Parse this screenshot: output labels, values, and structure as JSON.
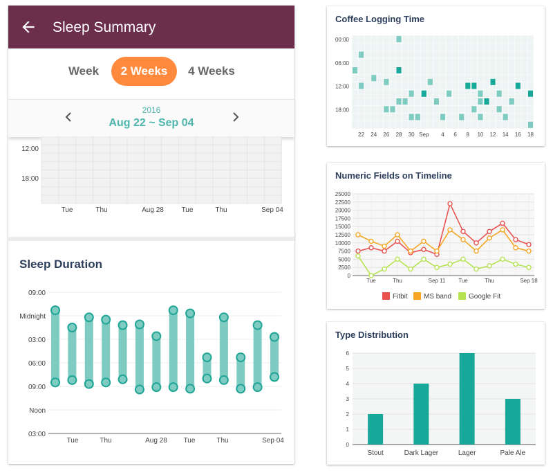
{
  "app": {
    "title": "Sleep Summary",
    "tabs": [
      "Week",
      "2 Weeks",
      "4 Weeks"
    ],
    "active_tab": "2 Weeks",
    "year": "2016",
    "date_range": "Aug 22 ~ Sep 04",
    "accent": "#4cb6ac",
    "header_color": "#6b2e4b",
    "tab_active_color": "#ff8a3d"
  },
  "sleep_overview": {
    "y_ticks": [
      "12:00",
      "18:00"
    ],
    "x_ticks": [
      "Tue",
      "Thu",
      "Aug 28",
      "Tue",
      "Thu",
      "Sep 04"
    ]
  },
  "sleep_duration": {
    "title": "Sleep Duration",
    "y_ticks": [
      "09:00",
      "Midnight",
      "03:00",
      "06:00",
      "09:00",
      "Noon",
      "03:00"
    ],
    "x_ticks": [
      "Tue",
      "Thu",
      "Aug 28",
      "Tue",
      "Thu",
      "Sep 04"
    ]
  },
  "coffee": {
    "title": "Coffee Logging Time",
    "y_ticks": [
      "00:00",
      "06:00",
      "12:00",
      "18:00"
    ],
    "x_ticks": [
      "22",
      "24",
      "26",
      "28",
      "30",
      "Sep",
      "4",
      "6",
      "8",
      "10",
      "12",
      "14",
      "16",
      "18"
    ]
  },
  "numeric": {
    "title": "Numeric Fields on Timeline",
    "y_ticks": [
      "25000",
      "22500",
      "20000",
      "17500",
      "15000",
      "12500",
      "10000",
      "7500",
      "5000",
      "2500",
      "0"
    ],
    "x_ticks": [
      "Tue",
      "Thu",
      "Sep 11",
      "Tue",
      "Thu",
      "Sep 18"
    ],
    "legend": [
      "Fitbit",
      "MS band",
      "Google Fit"
    ],
    "colors": [
      "#e8524f",
      "#f5a623",
      "#b5e352"
    ]
  },
  "type_dist": {
    "title": "Type Distribution",
    "color": "#17a89a"
  },
  "chart_data": [
    {
      "type": "heatmap",
      "title": "Coffee Logging Time",
      "x": [
        "Aug 21",
        "Aug 22",
        "Aug 23",
        "Aug 24",
        "Aug 25",
        "Aug 26",
        "Aug 27",
        "Aug 28",
        "Aug 29",
        "Aug 30",
        "Aug 31",
        "Sep 1",
        "Sep 2",
        "Sep 3",
        "Sep 4",
        "Sep 5",
        "Sep 6",
        "Sep 7",
        "Sep 8",
        "Sep 9",
        "Sep 10",
        "Sep 11",
        "Sep 12",
        "Sep 13",
        "Sep 14",
        "Sep 15",
        "Sep 16",
        "Sep 17",
        "Sep 18"
      ],
      "y_hours": [
        0,
        6,
        12,
        18
      ],
      "cells": [
        {
          "day": "Aug 22",
          "hour": 4,
          "level": 1
        },
        {
          "day": "Aug 21",
          "hour": 8,
          "level": 1
        },
        {
          "day": "Aug 22",
          "hour": 12,
          "level": 1
        },
        {
          "day": "Aug 24",
          "hour": 10,
          "level": 1
        },
        {
          "day": "Aug 26",
          "hour": 11,
          "level": 1
        },
        {
          "day": "Aug 28",
          "hour": 0,
          "level": 1
        },
        {
          "day": "Aug 28",
          "hour": 8,
          "level": 2
        },
        {
          "day": "Aug 28",
          "hour": 16,
          "level": 1
        },
        {
          "day": "Aug 26",
          "hour": 18,
          "level": 1
        },
        {
          "day": "Aug 27",
          "hour": 18,
          "level": 1
        },
        {
          "day": "Aug 29",
          "hour": 16,
          "level": 1
        },
        {
          "day": "Aug 30",
          "hour": 14,
          "level": 1
        },
        {
          "day": "Aug 30",
          "hour": 20,
          "level": 1
        },
        {
          "day": "Aug 31",
          "hour": 20,
          "level": 1
        },
        {
          "day": "Sep 1",
          "hour": 14,
          "level": 2
        },
        {
          "day": "Sep 2",
          "hour": 11,
          "level": 1
        },
        {
          "day": "Sep 3",
          "hour": 16,
          "level": 1
        },
        {
          "day": "Sep 4",
          "hour": 20,
          "level": 1
        },
        {
          "day": "Sep 5",
          "hour": 14,
          "level": 1
        },
        {
          "day": "Sep 7",
          "hour": 20,
          "level": 1
        },
        {
          "day": "Sep 8",
          "hour": 12,
          "level": 2
        },
        {
          "day": "Sep 9",
          "hour": 12,
          "level": 2
        },
        {
          "day": "Sep 9",
          "hour": 18,
          "level": 1
        },
        {
          "day": "Sep 10",
          "hour": 14,
          "level": 1
        },
        {
          "day": "Sep 10",
          "hour": 16,
          "level": 1
        },
        {
          "day": "Sep 10",
          "hour": 20,
          "level": 1
        },
        {
          "day": "Sep 11",
          "hour": 16,
          "level": 2
        },
        {
          "day": "Sep 12",
          "hour": 11,
          "level": 2
        },
        {
          "day": "Sep 13",
          "hour": 14,
          "level": 1
        },
        {
          "day": "Sep 13",
          "hour": 18,
          "level": 1
        },
        {
          "day": "Sep 14",
          "hour": 20,
          "level": 1
        },
        {
          "day": "Sep 15",
          "hour": 16,
          "level": 1
        },
        {
          "day": "Sep 16",
          "hour": 12,
          "level": 2
        },
        {
          "day": "Sep 18",
          "hour": 14,
          "level": 2
        },
        {
          "day": "Sep 18",
          "hour": 22,
          "level": 1
        }
      ]
    },
    {
      "type": "line",
      "title": "Numeric Fields on Timeline",
      "x": [
        "Sep 5",
        "Sep 6",
        "Sep 7",
        "Sep 8",
        "Sep 9",
        "Sep 10",
        "Sep 11",
        "Sep 12",
        "Sep 13",
        "Sep 14",
        "Sep 15",
        "Sep 16",
        "Sep 17",
        "Sep 18"
      ],
      "ylim": [
        0,
        25000
      ],
      "series": [
        {
          "name": "Fitbit",
          "values": [
            7500,
            8500,
            7500,
            10500,
            7000,
            8000,
            6500,
            22000,
            13500,
            10000,
            13500,
            16000,
            11000,
            9500
          ]
        },
        {
          "name": "MS band",
          "values": [
            12500,
            10500,
            9000,
            12500,
            7500,
            10500,
            7500,
            14000,
            11000,
            7500,
            11500,
            14000,
            8500,
            7500
          ]
        },
        {
          "name": "Google Fit",
          "values": [
            6000,
            0,
            2000,
            5000,
            2000,
            5000,
            2500,
            3500,
            5000,
            2000,
            3000,
            5000,
            3500,
            2500
          ]
        }
      ]
    },
    {
      "type": "bar",
      "title": "Type Distribution",
      "categories": [
        "Stout",
        "Dark Lager",
        "Lager",
        "Pale Ale"
      ],
      "values": [
        2,
        4,
        6,
        3
      ],
      "ylim": [
        0,
        6
      ]
    },
    {
      "type": "bar",
      "title": "Sleep Duration",
      "x": [
        "Aug 22",
        "Aug 23",
        "Aug 24",
        "Aug 25",
        "Aug 26",
        "Aug 27",
        "Aug 28",
        "Aug 29",
        "Aug 30",
        "Aug 31",
        "Sep 1",
        "Sep 2",
        "Sep 3",
        "Sep 4"
      ],
      "bedtime_hours_from_9pm": [
        2.3,
        4.5,
        3.2,
        3.5,
        4.2,
        4.1,
        5.6,
        2.3,
        2.7,
        8.3,
        3.2,
        8.3,
        4.2,
        5.7
      ],
      "wake_hours_from_9pm": [
        11.5,
        11.2,
        11.7,
        11.5,
        11.1,
        12.4,
        12.1,
        12.1,
        12.3,
        11.0,
        11.2,
        12.3,
        12.1,
        10.8
      ]
    }
  ]
}
